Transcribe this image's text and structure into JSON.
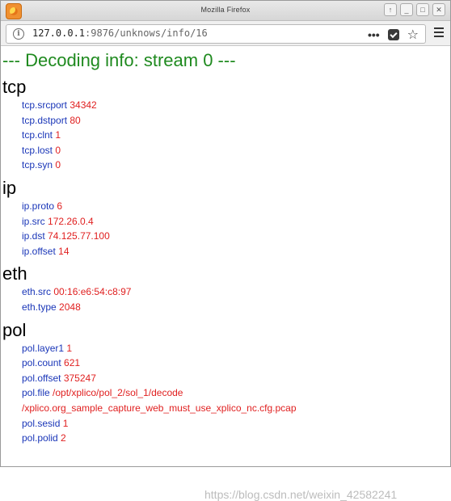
{
  "window": {
    "title": "Mozilla Firefox",
    "controls": [
      "↑",
      "_",
      "□",
      "✕"
    ]
  },
  "urlbar": {
    "host": "127.0.0.1",
    "path": ":9876/unknows/info/16"
  },
  "page": {
    "heading": "--- Decoding info: stream 0 ---",
    "sections": [
      {
        "title": "tcp",
        "fields": [
          {
            "key": "tcp.srcport",
            "value": "34342"
          },
          {
            "key": "tcp.dstport",
            "value": "80"
          },
          {
            "key": "tcp.clnt",
            "value": "1"
          },
          {
            "key": "tcp.lost",
            "value": "0"
          },
          {
            "key": "tcp.syn",
            "value": "0"
          }
        ]
      },
      {
        "title": "ip",
        "fields": [
          {
            "key": "ip.proto",
            "value": "6"
          },
          {
            "key": "ip.src",
            "value": "172.26.0.4"
          },
          {
            "key": "ip.dst",
            "value": "74.125.77.100"
          },
          {
            "key": "ip.offset",
            "value": "14"
          }
        ]
      },
      {
        "title": "eth",
        "fields": [
          {
            "key": "eth.src",
            "value": "00:16:e6:54:c8:97"
          },
          {
            "key": "eth.type",
            "value": "2048"
          }
        ]
      },
      {
        "title": "pol",
        "fields": [
          {
            "key": "pol.layer1",
            "value": "1"
          },
          {
            "key": "pol.count",
            "value": "621"
          },
          {
            "key": "pol.offset",
            "value": "375247"
          },
          {
            "key": "pol.file",
            "value": "/opt/xplico/pol_2/sol_1/decode"
          },
          {
            "key": "",
            "value": "/xplico.org_sample_capture_web_must_use_xplico_nc.cfg.pcap"
          },
          {
            "key": "pol.sesid",
            "value": "1"
          },
          {
            "key": "pol.polid",
            "value": "2"
          }
        ]
      }
    ]
  },
  "watermark": "https://blog.csdn.net/weixin_42582241"
}
